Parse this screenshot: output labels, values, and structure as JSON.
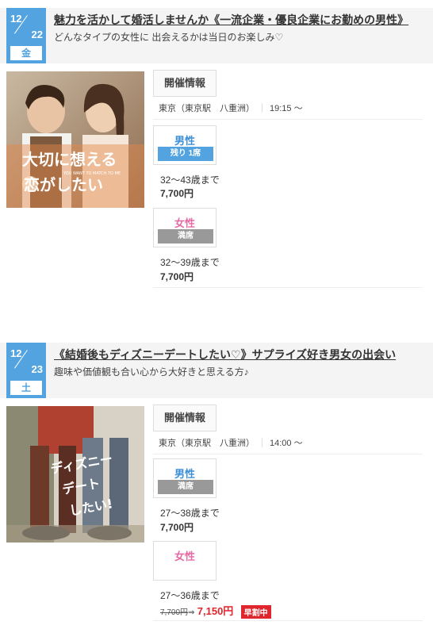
{
  "events": [
    {
      "date": {
        "month": "12",
        "day": "22",
        "weekday": "金"
      },
      "title": "魅力を活かして婚活しませんか《一流企業・優良企業にお勤めの男性》",
      "subtitle": "どんなタイプの女性に 出会えるかは当日のお楽しみ♡",
      "photo_text": {
        "line1": "大切に想える",
        "line2": "恋がしたい",
        "small": "YOU WANT TO MATCH TO ME"
      },
      "info_label": "開催情報",
      "location": "東京（東京駅　八重洲）",
      "time": "19:15 ～",
      "male": {
        "label": "男性",
        "status": "残り 1席",
        "age": "32～43歳まで",
        "price": "7,700円"
      },
      "female": {
        "label": "女性",
        "status": "満席",
        "age": "32～39歳まで",
        "price": "7,700円"
      }
    },
    {
      "date": {
        "month": "12",
        "day": "23",
        "weekday": "土"
      },
      "title": "《結婚後もディズニーデートしたい♡》サプライズ好き男女の出会い",
      "subtitle": "趣味や価値観も合い心から大好きと思える方♪",
      "photo_text": {
        "line1": "ディズニー",
        "line2": "デート",
        "line3": "したい!"
      },
      "info_label": "開催情報",
      "location": "東京（東京駅　八重洲）",
      "time": "14:00 ～",
      "male": {
        "label": "男性",
        "status": "満席",
        "age": "27～38歳まで",
        "price": "7,700円"
      },
      "female": {
        "label": "女性",
        "status": "",
        "age": "27～36歳まで",
        "old_price": "7,700円",
        "arrow": "⇒",
        "price": "7,150円",
        "badge": "早割中"
      }
    }
  ],
  "colors": {
    "accent": "#52a3df",
    "male": "#3d8fd8",
    "female": "#e86aa4",
    "sale": "#e0262c",
    "full": "#999999"
  }
}
